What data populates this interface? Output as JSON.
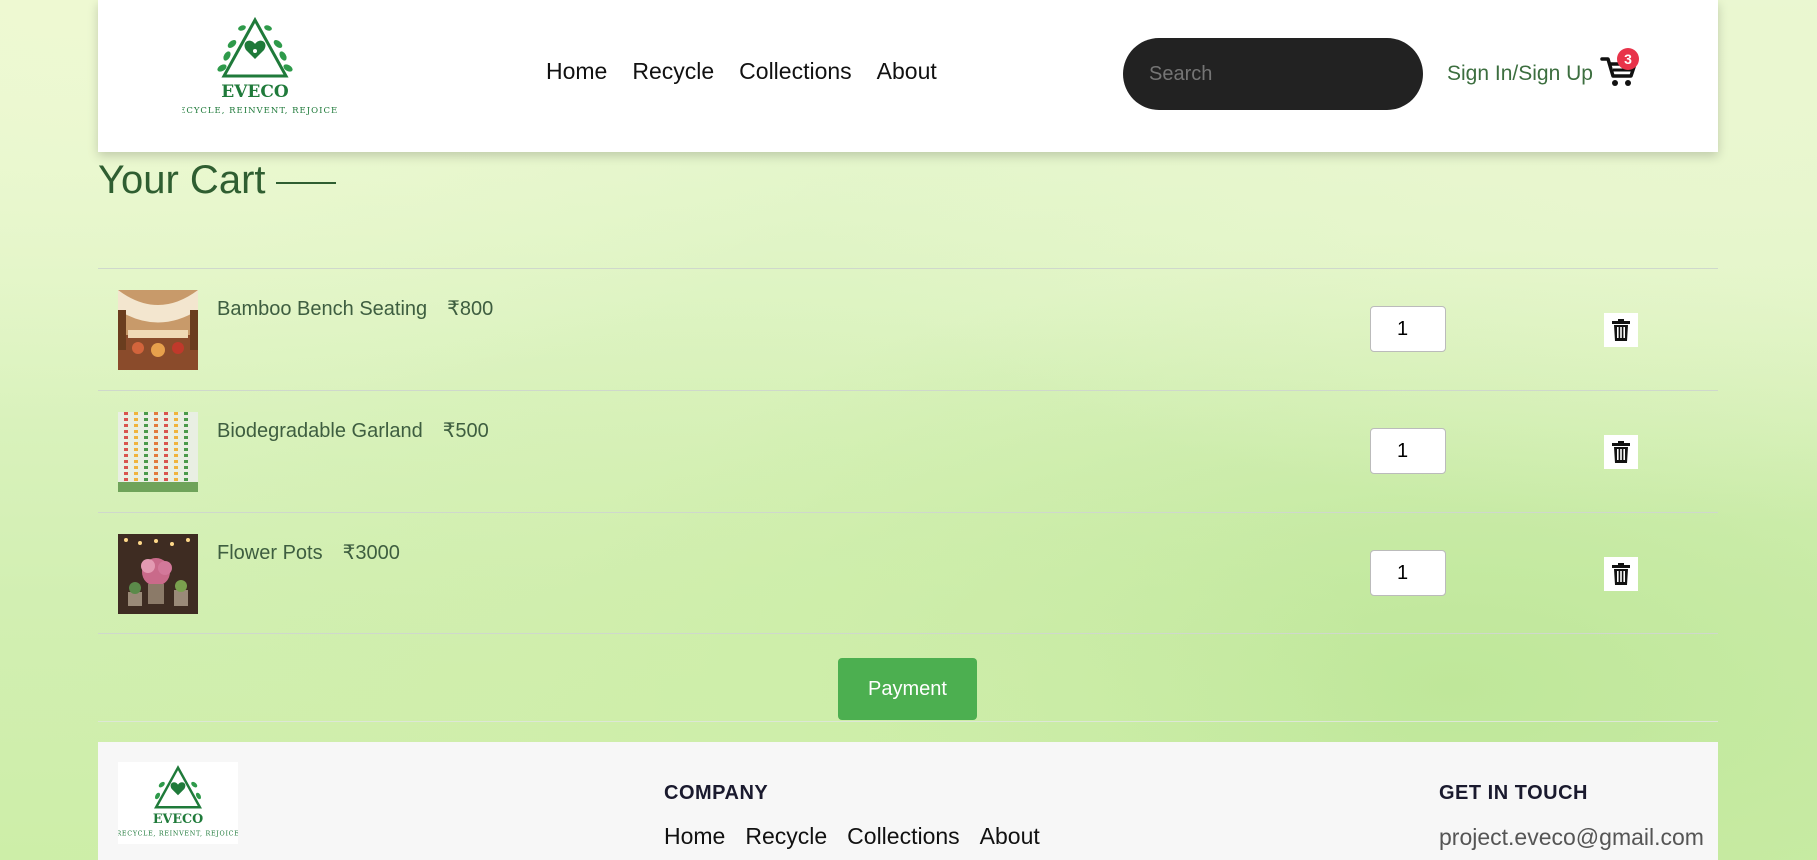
{
  "brand": {
    "name": "EVECO",
    "tagline": "RECYCLE, REINVENT, REJOICE",
    "color": "#1f7a3a"
  },
  "nav": {
    "items": [
      "Home",
      "Recycle",
      "Collections",
      "About"
    ]
  },
  "search": {
    "placeholder": "Search"
  },
  "auth": {
    "label": "Sign In/Sign Up"
  },
  "cart_badge": {
    "count": "3",
    "color": "#e8334a"
  },
  "cart": {
    "title": "Your Cart",
    "items": [
      {
        "name": "Bamboo Bench Seating",
        "price": "₹800",
        "quantity": "1"
      },
      {
        "name": "Biodegradable Garland",
        "price": "₹500",
        "quantity": "1"
      },
      {
        "name": "Flower Pots",
        "price": "₹3000",
        "quantity": "1"
      }
    ],
    "payment_label": "Payment",
    "payment_color": "#4caf50"
  },
  "footer": {
    "company_title": "COMPANY",
    "links": [
      "Home",
      "Recycle",
      "Collections",
      "About"
    ],
    "contact_title": "GET IN TOUCH",
    "email": "project.eveco@gmail.com"
  }
}
